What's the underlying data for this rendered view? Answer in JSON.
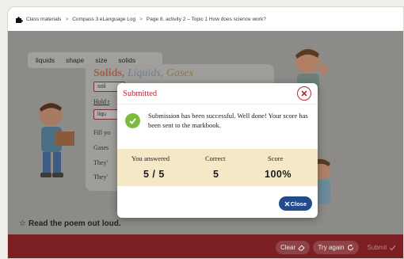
{
  "breadcrumb": {
    "items": [
      "Class materials",
      "Compass 3 eLanguage Log",
      "Page 8, activity 2 – Topic 1 How does science work?"
    ],
    "separator": ">"
  },
  "activity": {
    "word_bank": [
      "liquids",
      "shape",
      "size",
      "solids"
    ],
    "poem_title": [
      "Solids,",
      "Liquids,",
      "Gases"
    ],
    "blanks": [
      "soli",
      "liqu"
    ],
    "lines": [
      "Hold t",
      "Fill yo",
      "Gases",
      "They'",
      "They'"
    ],
    "instruction_star": "☆",
    "instruction": "Read the poem out loud."
  },
  "footer": {
    "clear_label": "Clear",
    "try_again_label": "Try again",
    "submit_label": "Submit"
  },
  "modal": {
    "title": "Submitted",
    "message": "Submission has been successful. Well done! Your score has been sent to the markbook.",
    "columns": [
      "You answered",
      "Correct",
      "Score"
    ],
    "values": [
      "5 / 5",
      "5",
      "100%"
    ],
    "close_label": "Close"
  },
  "colors": {
    "accent_red": "#b62834",
    "footer_bar": "#7b1f22",
    "success_green": "#7dbb3c",
    "score_band": "#f5e8c6",
    "close_button": "#234a8a"
  }
}
